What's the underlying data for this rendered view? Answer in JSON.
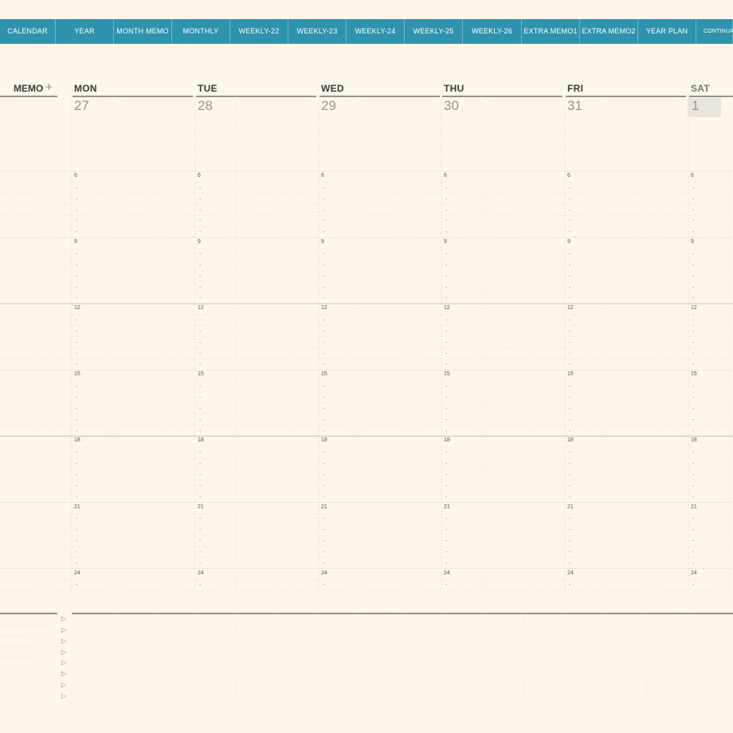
{
  "tabs": [
    {
      "label": "CALENDAR"
    },
    {
      "label": "YEAR"
    },
    {
      "label": "MONTH MEMO"
    },
    {
      "label": "MONTHLY"
    },
    {
      "label": "WEEKLY-22"
    },
    {
      "label": "WEEKLY-23"
    },
    {
      "label": "WEEKLY-24"
    },
    {
      "label": "WEEKLY-25"
    },
    {
      "label": "WEEKLY-26"
    },
    {
      "label": "EXTRA MEMO1"
    },
    {
      "label": "EXTRA MEMO2"
    },
    {
      "label": "YEAR PLAN"
    },
    {
      "label": "CONTINUA"
    }
  ],
  "memo": {
    "label": "MEMO",
    "plus": "+"
  },
  "days": [
    {
      "name": "MON",
      "date": "27"
    },
    {
      "name": "TUE",
      "date": "28"
    },
    {
      "name": "WED",
      "date": "29"
    },
    {
      "name": "THU",
      "date": "30"
    },
    {
      "name": "FRI",
      "date": "31"
    },
    {
      "name": "SAT",
      "date": "1",
      "highlighted": true
    }
  ],
  "hours": [
    "6",
    "9",
    "12",
    "15",
    "18",
    "21",
    "24"
  ],
  "colors": {
    "tabbar": "#2e93ae",
    "background": "#fdf6ea",
    "today_highlight": "#e9e4dc",
    "rule": "#555555"
  },
  "icons": {
    "notes_bullet": "triangle-right-icon"
  }
}
